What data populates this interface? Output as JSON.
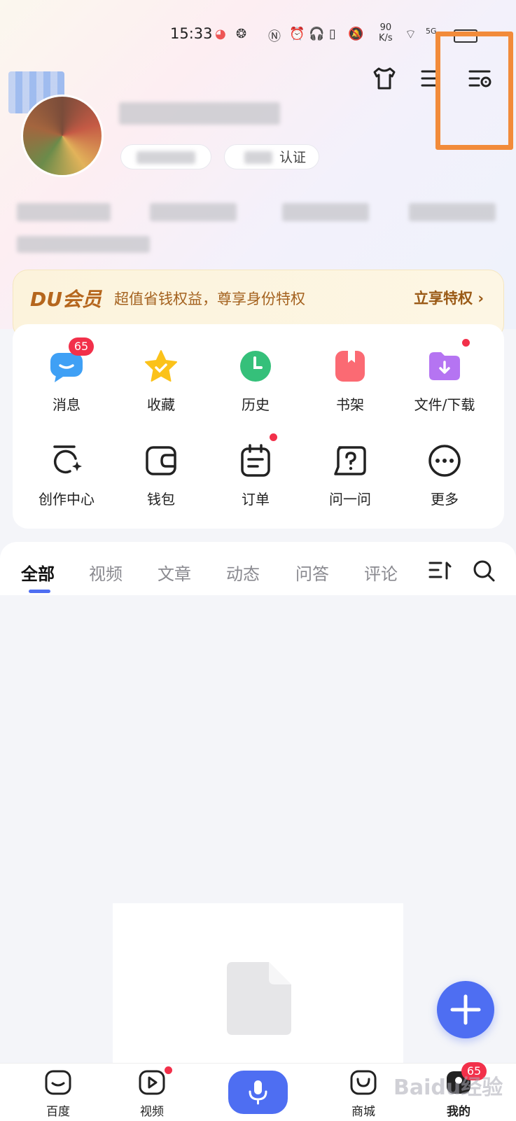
{
  "status_bar": {
    "time": "15:33",
    "net_speed_value": "90",
    "net_speed_unit": "K/s",
    "signal": "5G"
  },
  "vip": {
    "logo": "DU会员",
    "description": "超值省钱权益，尊享身份特权",
    "cta": "立享特权"
  },
  "profile": {
    "verify_label": "认证"
  },
  "quick_actions": [
    {
      "label": "消息",
      "icon": "message-icon",
      "badge": "65"
    },
    {
      "label": "收藏",
      "icon": "star-icon"
    },
    {
      "label": "历史",
      "icon": "clock-icon"
    },
    {
      "label": "书架",
      "icon": "bookshelf-icon"
    },
    {
      "label": "文件/下载",
      "icon": "download-folder-icon",
      "dot": true
    },
    {
      "label": "创作中心",
      "icon": "creation-icon"
    },
    {
      "label": "钱包",
      "icon": "wallet-icon"
    },
    {
      "label": "订单",
      "icon": "order-icon",
      "dot": true
    },
    {
      "label": "问一问",
      "icon": "question-icon"
    },
    {
      "label": "更多",
      "icon": "more-icon"
    }
  ],
  "tabs": [
    "全部",
    "视频",
    "文章",
    "动态",
    "问答",
    "评论"
  ],
  "bottom_nav": [
    {
      "label": "百度",
      "icon": "baidu-home-icon"
    },
    {
      "label": "视频",
      "icon": "video-icon"
    },
    {
      "label": "商城",
      "icon": "mall-icon"
    },
    {
      "label": "我的",
      "icon": "profile-icon",
      "badge": "65"
    }
  ],
  "watermark": "Baidu经验",
  "colors": {
    "accent": "#4e6ef2",
    "badge": "#f2304a",
    "highlight": "#f28b3a",
    "vip_text": "#b5661d"
  }
}
